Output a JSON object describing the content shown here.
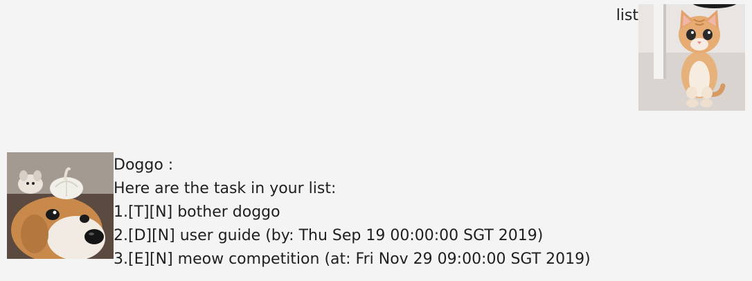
{
  "user_dialog": {
    "text": "list",
    "avatar": "cat-avatar"
  },
  "bot_dialog": {
    "avatar": "dog-avatar",
    "lines": [
      "Doggo :",
      "Here are the task in your list:",
      "1.[T][N] bother doggo",
      "2.[D][N] user guide (by: Thu Sep 19 00:00:00 SGT 2019)",
      "3.[E][N] meow competition (at: Fri Nov 29 09:00:00 SGT 2019)"
    ]
  },
  "colors": {
    "background": "#f4f4f4",
    "text": "#1f1f1f"
  }
}
